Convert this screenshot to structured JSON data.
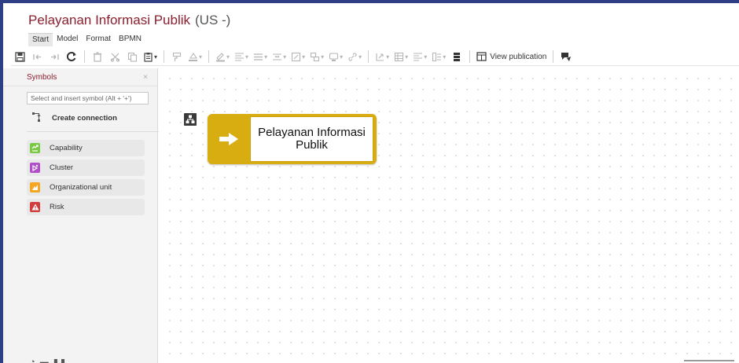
{
  "window": {
    "title": "Pelayanan Informasi Publik",
    "language": "(US -)"
  },
  "menu": {
    "items": [
      {
        "label": "Start",
        "active": true
      },
      {
        "label": "Model",
        "active": false
      },
      {
        "label": "Format",
        "active": false
      },
      {
        "label": "BPMN",
        "active": false
      }
    ]
  },
  "toolbar": {
    "icons": [
      "save-icon",
      "undo-icon",
      "redo-icon",
      "refresh-icon",
      "delete-icon",
      "cut-icon",
      "copy-icon",
      "paste-icon",
      "format-painter-icon",
      "fill-color-icon",
      "line-color-icon",
      "align-icon",
      "distribute-icon",
      "spacing-icon",
      "resize-icon",
      "arrange-icon",
      "shape-icon",
      "link-icon",
      "insert-icon",
      "table-icon",
      "layout-icon",
      "view-icon",
      "stack-icon",
      "publication-icon"
    ],
    "view_publication_label": "View publication"
  },
  "sidebar": {
    "title": "Symbols",
    "close_glyph": "×",
    "search_placeholder": "Select and insert symbol (Alt + '+')",
    "create_connection_label": "Create connection",
    "symbols": [
      {
        "label": "Capability",
        "icon": "capability-icon",
        "color": "#7ac943"
      },
      {
        "label": "Cluster",
        "icon": "cluster-icon",
        "color": "#b04fc9"
      },
      {
        "label": "Organizational unit",
        "icon": "org-unit-icon",
        "color": "#f5a623"
      },
      {
        "label": "Risk",
        "icon": "risk-icon",
        "color": "#d33c3c"
      }
    ]
  },
  "canvas": {
    "process_label": "Pelayanan Informasi Publik",
    "process_color": "#d8ad12"
  },
  "colors": {
    "accent": "#8a1f2e",
    "frame": "#2f3f86"
  }
}
